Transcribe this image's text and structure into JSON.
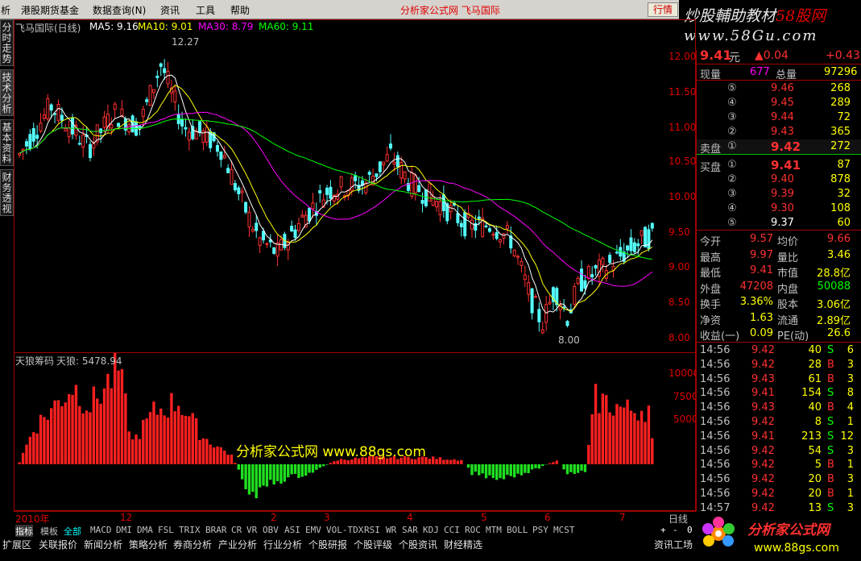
{
  "menu": {
    "items": [
      "析",
      "港股期货基金",
      "数据查询(N)",
      "资讯",
      "工具",
      "帮助"
    ],
    "title": "分析家公式网  飞马国际",
    "quote_btn": "行情"
  },
  "logo_top": {
    "line1": "炒股輔助教材",
    "line1_red": "58股网",
    "line2": "www.58Gu.com"
  },
  "left_tabs": [
    "分时走势",
    "技术分析",
    "基本资料",
    "财务透视"
  ],
  "main_header": {
    "name": "飞马国际(日线)",
    "ma5": "MA5: 9.16",
    "ma10": "MA10: 9.01",
    "ma30": "MA30: 8.79",
    "ma60": "MA60: 9.11",
    "ma5_color": "#ffffff",
    "ma10_color": "#ffff00",
    "ma30_color": "#ff00ff",
    "ma60_color": "#00ff00"
  },
  "price_axis": [
    "12.00",
    "11.50",
    "11.00",
    "10.50",
    "10.00",
    "9.50",
    "9.00",
    "8.50",
    "8.00"
  ],
  "high_marker": "12.27",
  "low_marker": "8.00",
  "ind_header": {
    "name": "天狼筹码",
    "value": "天狼: 5478.94"
  },
  "ind_axis": [
    "10000",
    "7500",
    "5000"
  ],
  "watermark": "分析家公式网  www.88gs.com",
  "time_axis": [
    "2010年",
    "12",
    "2",
    "3",
    "4",
    "5",
    "6",
    "7"
  ],
  "period": "日线",
  "bottom_tabs": [
    "指标",
    "模板",
    "全部",
    "MACD",
    "DMI",
    "DMA",
    "FSL",
    "TRIX",
    "BRAR",
    "CR",
    "VR",
    "OBV",
    "ASI",
    "EMV",
    "VOL-TDX",
    "RSI",
    "WR",
    "SAR",
    "KDJ",
    "CCI",
    "ROC",
    "MTM",
    "BOLL",
    "PSY",
    "MCST"
  ],
  "status_tabs": [
    "扩展区",
    "关联报价",
    "新闻分析",
    "策略分析",
    "券商分析",
    "产业分析",
    "行业分析",
    "个股研报",
    "个股评级",
    "个股资讯",
    "财经精选"
  ],
  "status_right": "资讯工场",
  "quote": {
    "price": "9.41",
    "unit": "元",
    "change": "▲0.04",
    "pct": "+0.43",
    "xianliang_label": "现量",
    "xianliang": "677",
    "zongliang_label": "总量",
    "zongliang": "97296",
    "sell_label": "卖盘",
    "buy_label": "买盘",
    "sells": [
      {
        "lvl": "⑤",
        "price": "9.46",
        "vol": "268"
      },
      {
        "lvl": "④",
        "price": "9.45",
        "vol": "289"
      },
      {
        "lvl": "③",
        "price": "9.44",
        "vol": "72"
      },
      {
        "lvl": "②",
        "price": "9.43",
        "vol": "365"
      },
      {
        "lvl": "①",
        "price": "9.42",
        "vol": "272"
      }
    ],
    "buys": [
      {
        "lvl": "①",
        "price": "9.41",
        "vol": "87"
      },
      {
        "lvl": "②",
        "price": "9.40",
        "vol": "878"
      },
      {
        "lvl": "③",
        "price": "9.39",
        "vol": "32"
      },
      {
        "lvl": "④",
        "price": "9.30",
        "vol": "108"
      },
      {
        "lvl": "⑤",
        "price": "9.37",
        "vol": "60"
      }
    ],
    "stats": [
      {
        "l1": "今开",
        "v1": "9.57",
        "l2": "均价",
        "v2": "9.66"
      },
      {
        "l1": "最高",
        "v1": "9.97",
        "l2": "量比",
        "v2": "3.46"
      },
      {
        "l1": "最低",
        "v1": "9.41",
        "l2": "市值",
        "v2": "28.8亿"
      },
      {
        "l1": "外盘",
        "v1": "47208",
        "l2": "内盘",
        "v2": "50088"
      },
      {
        "l1": "换手",
        "v1": "3.36%",
        "l2": "股本",
        "v2": "3.06亿"
      },
      {
        "l1": "净资",
        "v1": "1.63",
        "l2": "流通",
        "v2": "2.89亿"
      },
      {
        "l1": "收益(一)",
        "v1": "0.09",
        "l2": "PE(动)",
        "v2": "26.6"
      }
    ],
    "ticks": [
      {
        "t": "14:56",
        "p": "9.42",
        "v": "40",
        "bs": "S",
        "n": "6"
      },
      {
        "t": "14:56",
        "p": "9.42",
        "v": "28",
        "bs": "B",
        "n": "3"
      },
      {
        "t": "14:56",
        "p": "9.43",
        "v": "61",
        "bs": "B",
        "n": "3"
      },
      {
        "t": "14:56",
        "p": "9.41",
        "v": "154",
        "bs": "S",
        "n": "8"
      },
      {
        "t": "14:56",
        "p": "9.43",
        "v": "40",
        "bs": "B",
        "n": "4"
      },
      {
        "t": "14:56",
        "p": "9.42",
        "v": "8",
        "bs": "S",
        "n": "1"
      },
      {
        "t": "14:56",
        "p": "9.41",
        "v": "213",
        "bs": "S",
        "n": "12"
      },
      {
        "t": "14:56",
        "p": "9.42",
        "v": "54",
        "bs": "S",
        "n": "3"
      },
      {
        "t": "14:56",
        "p": "9.42",
        "v": "5",
        "bs": "B",
        "n": "1"
      },
      {
        "t": "14:56",
        "p": "9.42",
        "v": "20",
        "bs": "B",
        "n": "3"
      },
      {
        "t": "14:56",
        "p": "9.42",
        "v": "20",
        "bs": "B",
        "n": "1"
      },
      {
        "t": "14:57",
        "p": "9.42",
        "v": "13",
        "bs": "S",
        "n": "3"
      }
    ]
  },
  "logo_bottom": {
    "title": "分析家公式网",
    "url": "www.88gs.com"
  }
}
